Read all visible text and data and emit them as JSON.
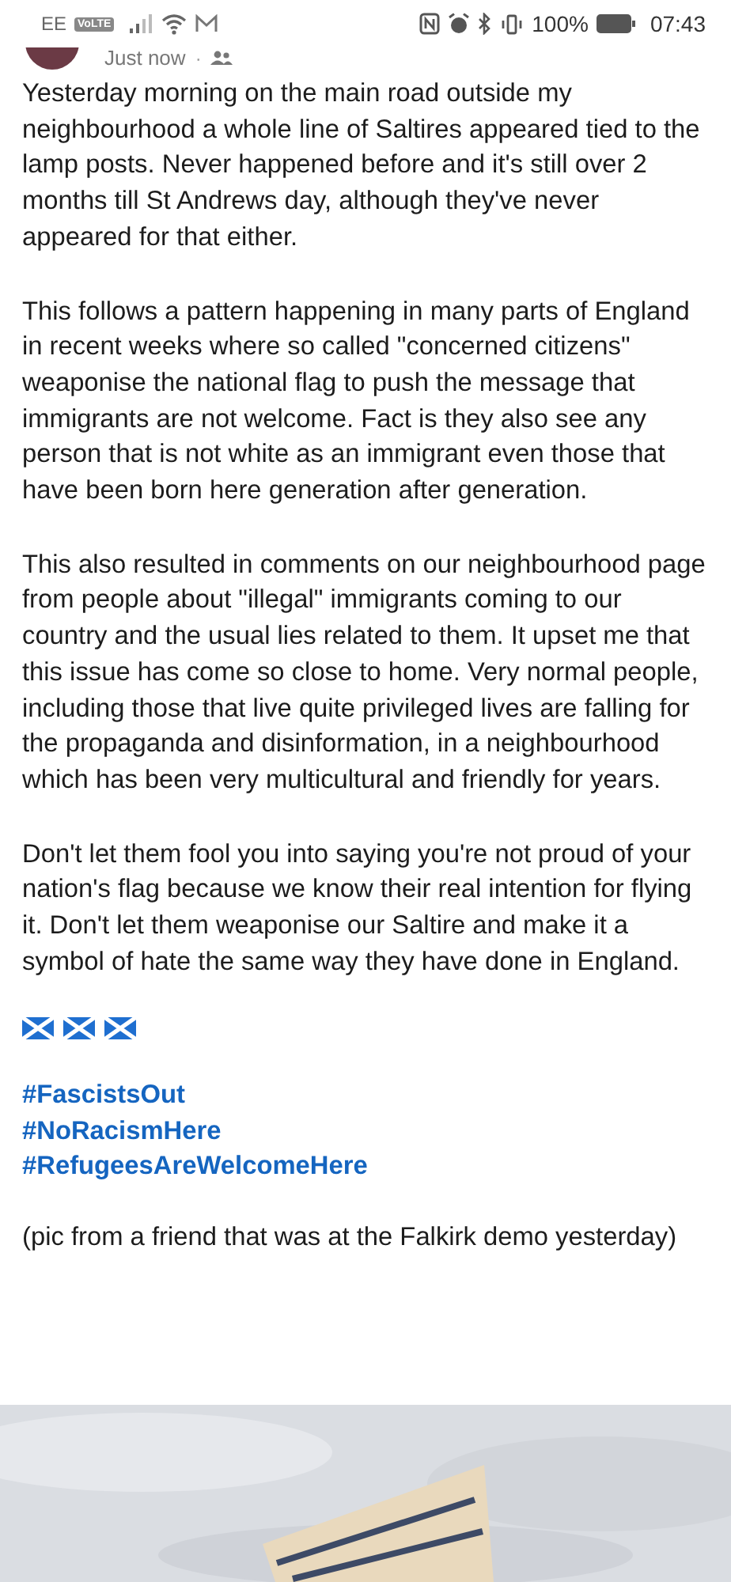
{
  "status_bar": {
    "carrier": "EE",
    "network_badge": "VoLTE",
    "battery": "100%",
    "time": "07:43"
  },
  "post": {
    "time": "Just now",
    "separator": "·",
    "paragraphs": [
      "Yesterday morning on the main road outside my neighbourhood a whole line of Saltires appeared tied to the lamp posts. Never happened before and it's still over 2 months till St Andrews day, although they've never appeared for that either.",
      "This follows a pattern happening in many parts of England in recent weeks where so called \"concerned citizens\" weaponise the national flag to push the message that immigrants are not welcome. Fact is they also see any person that is not white as an immigrant even those that have been born here generation after generation.",
      "This also resulted in comments on our neighbourhood page from people about \"illegal\" immigrants coming to our country and the usual lies related to them. It upset me that this issue has come so close to home. Very normal people, including those that live quite privileged lives are falling for the propaganda and disinformation, in a neighbourhood which has been very multicultural and friendly for years.",
      "Don't let them fool you into saying you're not proud of your nation's flag because we know their real intention for flying it. Don't let them weaponise our Saltire and make it a symbol of hate the same way they have done in England."
    ],
    "hashtags": [
      "#FascistsOut",
      "#NoRacismHere",
      "#RefugeesAreWelcomeHere"
    ],
    "caption": "(pic from a friend that was at the Falkirk demo yesterday)",
    "photo": {
      "kind": "picture"
    }
  }
}
